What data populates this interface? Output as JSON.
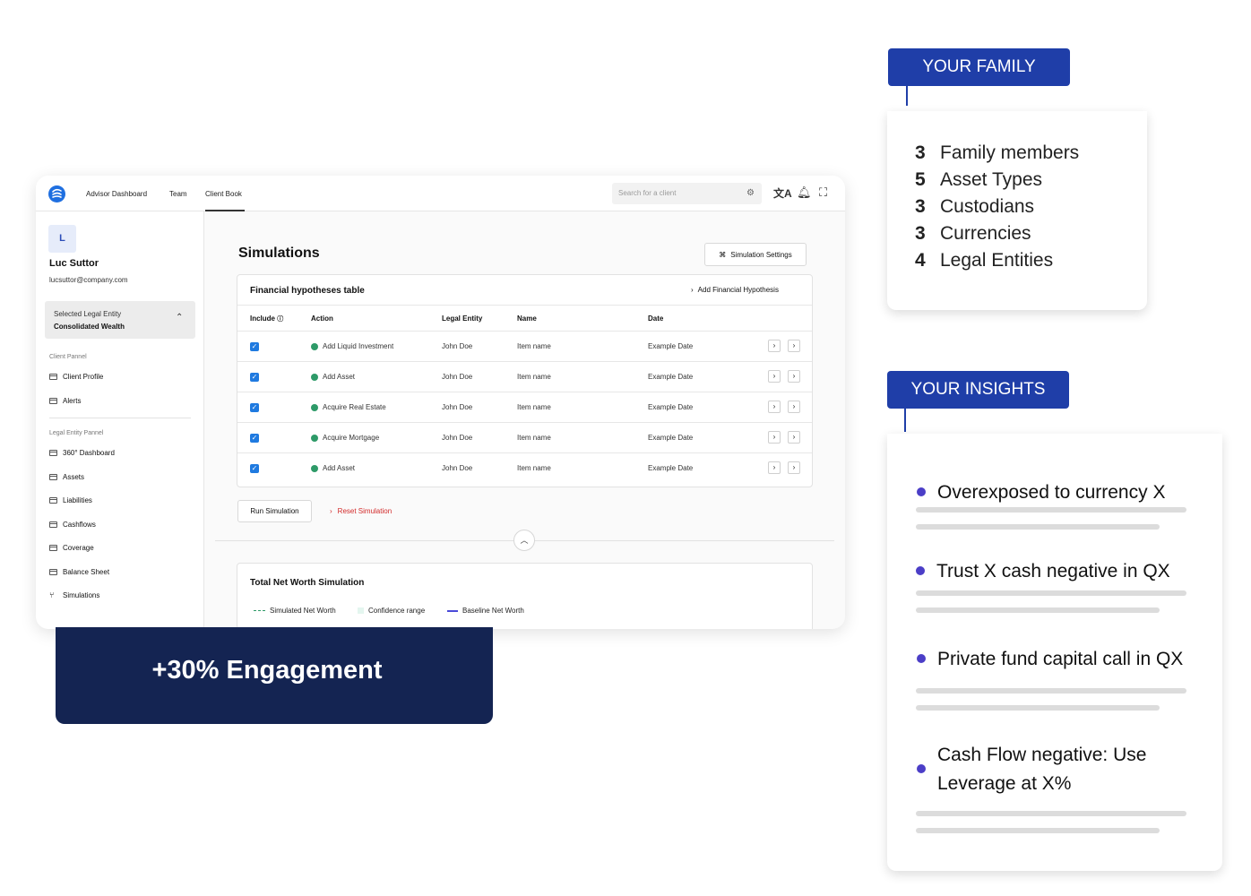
{
  "app": {
    "nav": [
      "Advisor Dashboard",
      "Team",
      "Client Book"
    ],
    "search_placeholder": "Search for a client",
    "user": {
      "initial": "L",
      "name": "Luc Suttor",
      "email": "lucsuttor@company.com"
    },
    "entity_select": {
      "label": "Selected Legal Entity",
      "value": "Consolidated Wealth"
    },
    "client_panel": {
      "title": "Client Pannel",
      "items": [
        "Client Profile",
        "Alerts"
      ]
    },
    "legal_entity_panel": {
      "title": "Legal Entity Pannel",
      "items": [
        "360° Dashboard",
        "Assets",
        "Liabilities",
        "Cashflows",
        "Coverage",
        "Balance Sheet",
        "Simulations"
      ]
    },
    "main": {
      "title": "Simulations",
      "settings_button": "Simulation Settings",
      "table_title": "Financial hypotheses table",
      "add_hypothesis": "Add Financial Hypothesis",
      "columns": [
        "Include",
        "Action",
        "Legal Entity",
        "Name",
        "Date"
      ],
      "rows": [
        {
          "action": "Add Liquid Investment",
          "entity": "John Doe",
          "name": "Item name",
          "date": "Example Date"
        },
        {
          "action": "Add Asset",
          "entity": "John Doe",
          "name": "Item name",
          "date": "Example Date"
        },
        {
          "action": "Acquire Real Estate",
          "entity": "John Doe",
          "name": "Item name",
          "date": "Example Date"
        },
        {
          "action": "Acquire Mortgage",
          "entity": "John Doe",
          "name": "Item name",
          "date": "Example Date"
        },
        {
          "action": "Add Asset",
          "entity": "John Doe",
          "name": "Item name",
          "date": "Example Date"
        }
      ],
      "run_button": "Run Simulation",
      "reset_link": "Reset Simulation",
      "chart_title": "Total Net Worth Simulation",
      "legend": [
        "Simulated Net Worth",
        "Confidence range",
        "Baseline Net Worth"
      ]
    }
  },
  "engagement": "+30% Engagement",
  "family": {
    "tag": "YOUR FAMILY",
    "items": [
      {
        "num": "3",
        "label": "Family members"
      },
      {
        "num": "5",
        "label": "Asset Types"
      },
      {
        "num": "3",
        "label": "Custodians"
      },
      {
        "num": "3",
        "label": "Currencies"
      },
      {
        "num": "4",
        "label": "Legal Entities"
      }
    ]
  },
  "insights": {
    "tag": "YOUR INSIGHTS",
    "items": [
      "Overexposed to currency X",
      "Trust X cash negative in QX",
      "Private fund capital call in QX",
      "Cash Flow negative: Use Leverage at X%"
    ]
  },
  "colors": {
    "brand_navy": "#142452",
    "tag_blue": "#1f3ea8",
    "accent_purple": "#4b3ec7",
    "check_blue": "#1f7ae0",
    "action_green": "#2e9a68",
    "reset_red": "#d22a2a"
  }
}
